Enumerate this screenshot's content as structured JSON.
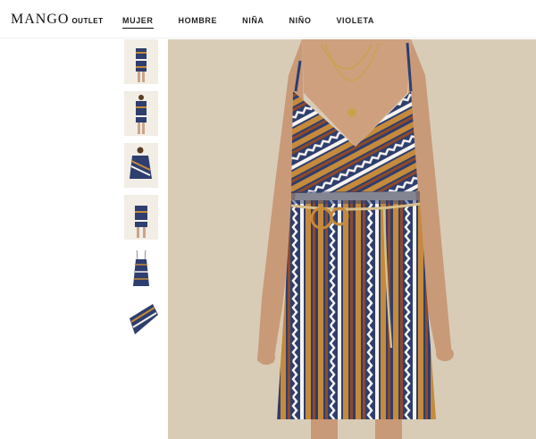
{
  "brand": {
    "name": "MANGO",
    "sub": "OUTLET"
  },
  "nav": {
    "items": [
      "MUJER",
      "HOMBRE",
      "NIÑA",
      "NIÑO",
      "VIOLETA"
    ],
    "active": "MUJER"
  },
  "gallery": {
    "thumbnail_count": 6
  },
  "colors": {
    "navy": "#2e3e6e",
    "mustard": "#c58a3b",
    "rust": "#8e4a28",
    "white": "#f6f3ee",
    "background": "#d8ccb7"
  }
}
